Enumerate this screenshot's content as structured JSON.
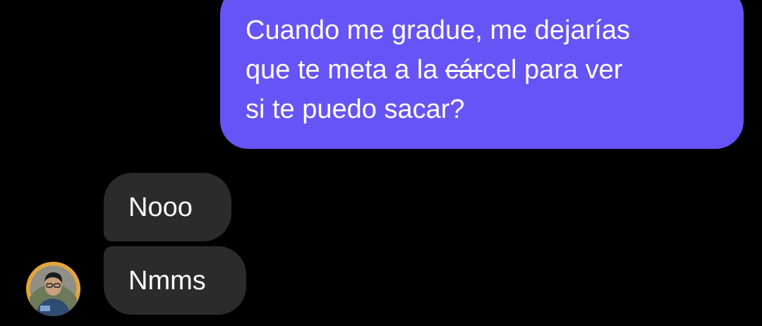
{
  "conversation": {
    "outgoing": [
      {
        "lines": [
          {
            "before": "Cuando me gradue, me dejarías",
            "strike": "",
            "after": ""
          },
          {
            "before": "que te meta a la ",
            "strike": "cár",
            "after": "cel para ver"
          },
          {
            "before": "si te puedo sacar?",
            "strike": "",
            "after": ""
          }
        ]
      }
    ],
    "incoming": [
      {
        "text": "Nooo"
      },
      {
        "text": "Nmms"
      }
    ]
  },
  "colors": {
    "background": "#000000",
    "outgoing_bubble": "#6654f6",
    "incoming_bubble": "#2b2b2b",
    "text": "#ffffff",
    "avatar_ring": "#e2a53a"
  },
  "icons": {
    "avatar": "contact-avatar-photo"
  }
}
